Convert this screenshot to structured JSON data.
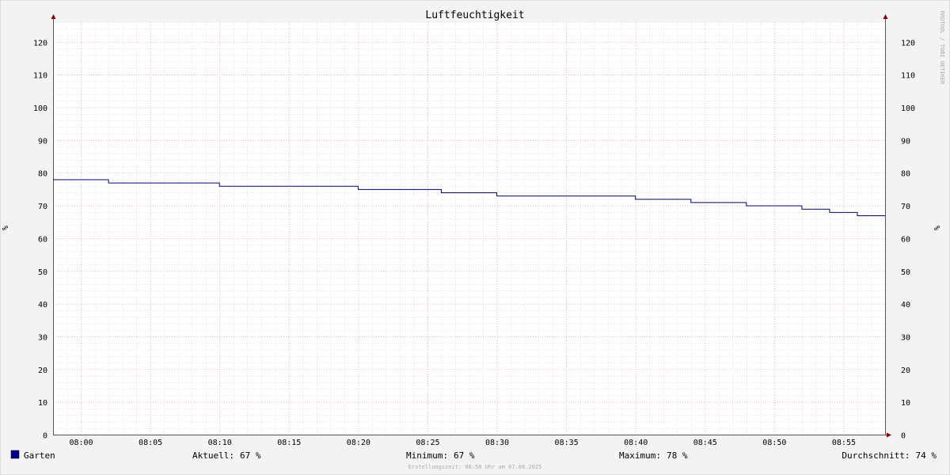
{
  "chart_data": {
    "type": "line",
    "title": "Luftfeuchtigkeit",
    "ylabel": "%",
    "ylim": [
      0,
      126
    ],
    "y_ticks": [
      0,
      10,
      20,
      30,
      40,
      50,
      60,
      70,
      80,
      90,
      100,
      110,
      120
    ],
    "x_range": [
      "07:58",
      "08:58"
    ],
    "x_ticks": [
      "08:00",
      "08:05",
      "08:10",
      "08:15",
      "08:20",
      "08:25",
      "08:30",
      "08:35",
      "08:40",
      "08:45",
      "08:50",
      "08:55"
    ],
    "watermark": "RRDTOOL / TOBI OETIKER",
    "grid": true,
    "series": [
      {
        "name": "Garten",
        "color": "#00008b",
        "step": true,
        "points": [
          {
            "x": "07:58",
            "y": 78
          },
          {
            "x": "08:02",
            "y": 77
          },
          {
            "x": "08:10",
            "y": 76
          },
          {
            "x": "08:20",
            "y": 75
          },
          {
            "x": "08:26",
            "y": 74
          },
          {
            "x": "08:30",
            "y": 73
          },
          {
            "x": "08:40",
            "y": 72
          },
          {
            "x": "08:44",
            "y": 71
          },
          {
            "x": "08:48",
            "y": 70
          },
          {
            "x": "08:52",
            "y": 69
          },
          {
            "x": "08:54",
            "y": 68
          },
          {
            "x": "08:56",
            "y": 67
          },
          {
            "x": "08:58",
            "y": 67
          }
        ]
      }
    ],
    "legend": {
      "swatch_color": "#00008b",
      "series_label": "Garten",
      "current_label": "Aktuell:",
      "current_value": "67 %",
      "min_label": "Minimum:",
      "min_value": "67 %",
      "max_label": "Maximum:",
      "max_value": "78 %",
      "avg_label": "Durchschnitt:",
      "avg_value": "74 %"
    },
    "footer": "Erstellungszeit: 08:58 Uhr am 07.08.2025"
  },
  "colors": {
    "background": "#f3f3f3",
    "canvas": "#ffffff",
    "major_grid": "#e8a0a8",
    "minor_grid": "#d0d0d0",
    "axis": "#555555",
    "arrow": "#8b0000",
    "line": "#00008b",
    "text": "#000000",
    "muted_text": "#aaaaaa"
  }
}
